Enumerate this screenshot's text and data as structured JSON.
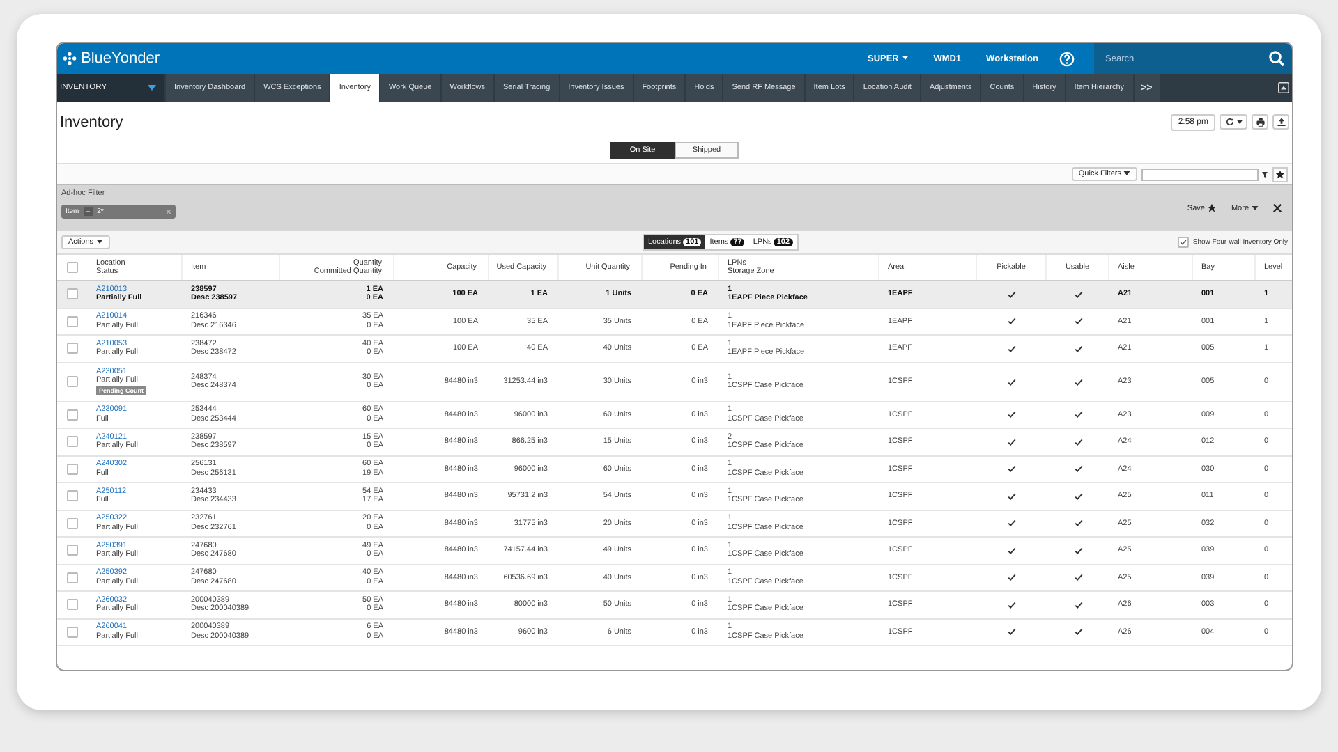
{
  "header": {
    "logo": "BlueYonder",
    "user_menu": "SUPER",
    "warehouse": "WMD1",
    "workstation": "Workstation",
    "search": {
      "placeholder": "Search"
    }
  },
  "nav": {
    "module": "INVENTORY",
    "tabs": [
      {
        "label": "Inventory Dashboard",
        "selected": false
      },
      {
        "label": "WCS Exceptions",
        "selected": false
      },
      {
        "label": "Inventory",
        "selected": true
      },
      {
        "label": "Work Queue",
        "selected": false
      },
      {
        "label": "Workflows",
        "selected": false
      },
      {
        "label": "Serial Tracing",
        "selected": false
      },
      {
        "label": "Inventory Issues",
        "selected": false
      },
      {
        "label": "Footprints",
        "selected": false
      },
      {
        "label": "Holds",
        "selected": false
      },
      {
        "label": "Send RF Message",
        "selected": false
      },
      {
        "label": "Item Lots",
        "selected": false
      },
      {
        "label": "Location Audit",
        "selected": false
      },
      {
        "label": "Adjustments",
        "selected": false
      },
      {
        "label": "Counts",
        "selected": false
      },
      {
        "label": "History",
        "selected": false
      },
      {
        "label": "Item Hierarchy",
        "selected": false
      }
    ],
    "more": ">>"
  },
  "page": {
    "title": "Inventory",
    "time": "2:58 pm"
  },
  "site_toggle": [
    {
      "label": "On Site",
      "selected": true
    },
    {
      "label": "Shipped",
      "selected": false
    }
  ],
  "quick_filters": {
    "label": "Quick Filters"
  },
  "adhoc_filter": {
    "title": "Ad-hoc Filter",
    "chip": {
      "field": "Item",
      "operator": "=",
      "value": "2*"
    },
    "save": "Save",
    "more": "More"
  },
  "actions": "Actions",
  "result_tabs": [
    {
      "label": "Locations",
      "count": "101",
      "selected": true
    },
    {
      "label": "Items",
      "count": "77",
      "selected": false
    },
    {
      "label": "LPNs",
      "count": "102",
      "selected": false
    }
  ],
  "four_wall": {
    "label": "Show Four-wall Inventory Only",
    "checked": true
  },
  "table": {
    "select_all": {
      "checked": false
    },
    "columns": [
      {
        "label": "Location",
        "sub": "Status"
      },
      {
        "label": "Item"
      },
      {
        "label": "Quantity",
        "sub": "Committed Quantity"
      },
      {
        "label": "Capacity"
      },
      {
        "label": "Used Capacity"
      },
      {
        "label": "Unit Quantity"
      },
      {
        "label": "Pending In"
      },
      {
        "label": "LPNs",
        "sub": "Storage Zone"
      },
      {
        "label": "Area"
      },
      {
        "label": "Pickable"
      },
      {
        "label": "Usable"
      },
      {
        "label": "Aisle"
      },
      {
        "label": "Bay"
      },
      {
        "label": "Level"
      }
    ],
    "rows": [
      {
        "selected": true,
        "checked": false,
        "location": "A210013",
        "status": "Partially Full",
        "item": "238597",
        "desc": "Desc 238597",
        "qty": "1 EA",
        "committed": "0 EA",
        "capacity": "100 EA",
        "used": "1 EA",
        "units": "1 Units",
        "pending": "0 EA",
        "lpns": "1",
        "zone": "1EAPF Piece Pickface",
        "area": "1EAPF",
        "pickable": true,
        "usable": true,
        "aisle": "A21",
        "bay": "001",
        "level": "1"
      },
      {
        "selected": false,
        "checked": false,
        "location": "A210014",
        "status": "Partially Full",
        "item": "216346",
        "desc": "Desc 216346",
        "qty": "35 EA",
        "committed": "0 EA",
        "capacity": "100 EA",
        "used": "35 EA",
        "units": "35 Units",
        "pending": "0 EA",
        "lpns": "1",
        "zone": "1EAPF Piece Pickface",
        "area": "1EAPF",
        "pickable": true,
        "usable": true,
        "aisle": "A21",
        "bay": "001",
        "level": "1"
      },
      {
        "selected": false,
        "checked": false,
        "location": "A210053",
        "status": "Partially Full",
        "item": "238472",
        "desc": "Desc 238472",
        "qty": "40 EA",
        "committed": "0 EA",
        "capacity": "100 EA",
        "used": "40 EA",
        "units": "40 Units",
        "pending": "0 EA",
        "lpns": "1",
        "zone": "1EAPF Piece Pickface",
        "area": "1EAPF",
        "pickable": true,
        "usable": true,
        "aisle": "A21",
        "bay": "005",
        "level": "1"
      },
      {
        "selected": false,
        "checked": false,
        "location": "A230051",
        "status": "Partially Full",
        "badge": "Pending Count",
        "item": "248374",
        "desc": "Desc 248374",
        "qty": "30 EA",
        "committed": "0 EA",
        "capacity": "84480 in3",
        "used": "31253.44 in3",
        "units": "30 Units",
        "pending": "0 in3",
        "lpns": "1",
        "zone": "1CSPF Case Pickface",
        "area": "1CSPF",
        "pickable": true,
        "usable": true,
        "aisle": "A23",
        "bay": "005",
        "level": "0"
      },
      {
        "selected": false,
        "checked": false,
        "location": "A230091",
        "status": "Full",
        "item": "253444",
        "desc": "Desc 253444",
        "qty": "60 EA",
        "committed": "0 EA",
        "capacity": "84480 in3",
        "used": "96000 in3",
        "units": "60 Units",
        "pending": "0 in3",
        "lpns": "1",
        "zone": "1CSPF Case Pickface",
        "area": "1CSPF",
        "pickable": true,
        "usable": true,
        "aisle": "A23",
        "bay": "009",
        "level": "0"
      },
      {
        "selected": false,
        "checked": false,
        "location": "A240121",
        "status": "Partially Full",
        "item": "238597",
        "desc": "Desc 238597",
        "qty": "15 EA",
        "committed": "0 EA",
        "capacity": "84480 in3",
        "used": "866.25 in3",
        "units": "15 Units",
        "pending": "0 in3",
        "lpns": "2",
        "zone": "1CSPF Case Pickface",
        "area": "1CSPF",
        "pickable": true,
        "usable": true,
        "aisle": "A24",
        "bay": "012",
        "level": "0"
      },
      {
        "selected": false,
        "checked": false,
        "location": "A240302",
        "status": "Full",
        "item": "256131",
        "desc": "Desc 256131",
        "qty": "60 EA",
        "committed": "19 EA",
        "capacity": "84480 in3",
        "used": "96000 in3",
        "units": "60 Units",
        "pending": "0 in3",
        "lpns": "1",
        "zone": "1CSPF Case Pickface",
        "area": "1CSPF",
        "pickable": true,
        "usable": true,
        "aisle": "A24",
        "bay": "030",
        "level": "0"
      },
      {
        "selected": false,
        "checked": false,
        "location": "A250112",
        "status": "Full",
        "item": "234433",
        "desc": "Desc 234433",
        "qty": "54 EA",
        "committed": "17 EA",
        "capacity": "84480 in3",
        "used": "95731.2 in3",
        "units": "54 Units",
        "pending": "0 in3",
        "lpns": "1",
        "zone": "1CSPF Case Pickface",
        "area": "1CSPF",
        "pickable": true,
        "usable": true,
        "aisle": "A25",
        "bay": "011",
        "level": "0"
      },
      {
        "selected": false,
        "checked": false,
        "location": "A250322",
        "status": "Partially Full",
        "item": "232761",
        "desc": "Desc 232761",
        "qty": "20 EA",
        "committed": "0 EA",
        "capacity": "84480 in3",
        "used": "31775 in3",
        "units": "20 Units",
        "pending": "0 in3",
        "lpns": "1",
        "zone": "1CSPF Case Pickface",
        "area": "1CSPF",
        "pickable": true,
        "usable": true,
        "aisle": "A25",
        "bay": "032",
        "level": "0"
      },
      {
        "selected": false,
        "checked": false,
        "location": "A250391",
        "status": "Partially Full",
        "item": "247680",
        "desc": "Desc 247680",
        "qty": "49 EA",
        "committed": "0 EA",
        "capacity": "84480 in3",
        "used": "74157.44 in3",
        "units": "49 Units",
        "pending": "0 in3",
        "lpns": "1",
        "zone": "1CSPF Case Pickface",
        "area": "1CSPF",
        "pickable": true,
        "usable": true,
        "aisle": "A25",
        "bay": "039",
        "level": "0"
      },
      {
        "selected": false,
        "checked": false,
        "location": "A250392",
        "status": "Partially Full",
        "item": "247680",
        "desc": "Desc 247680",
        "qty": "40 EA",
        "committed": "0 EA",
        "capacity": "84480 in3",
        "used": "60536.69 in3",
        "units": "40 Units",
        "pending": "0 in3",
        "lpns": "1",
        "zone": "1CSPF Case Pickface",
        "area": "1CSPF",
        "pickable": true,
        "usable": true,
        "aisle": "A25",
        "bay": "039",
        "level": "0"
      },
      {
        "selected": false,
        "checked": false,
        "location": "A260032",
        "status": "Partially Full",
        "item": "200040389",
        "desc": "Desc 200040389",
        "qty": "50 EA",
        "committed": "0 EA",
        "capacity": "84480 in3",
        "used": "80000 in3",
        "units": "50 Units",
        "pending": "0 in3",
        "lpns": "1",
        "zone": "1CSPF Case Pickface",
        "area": "1CSPF",
        "pickable": true,
        "usable": true,
        "aisle": "A26",
        "bay": "003",
        "level": "0"
      },
      {
        "selected": false,
        "checked": false,
        "location": "A260041",
        "status": "Partially Full",
        "item": "200040389",
        "desc": "Desc 200040389",
        "qty": "6 EA",
        "committed": "0 EA",
        "capacity": "84480 in3",
        "used": "9600 in3",
        "units": "6 Units",
        "pending": "0 in3",
        "lpns": "1",
        "zone": "1CSPF Case Pickface",
        "area": "1CSPF",
        "pickable": true,
        "usable": true,
        "aisle": "A26",
        "bay": "004",
        "level": "0"
      }
    ]
  }
}
